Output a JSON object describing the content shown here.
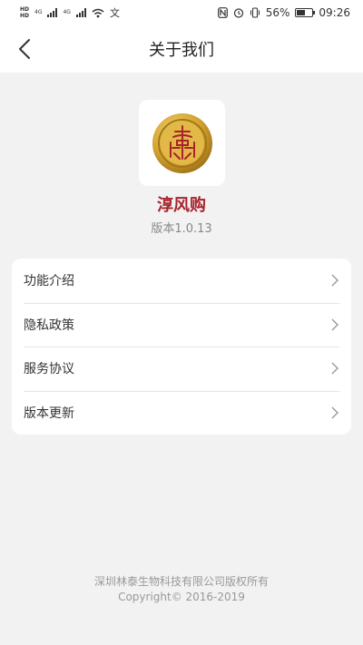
{
  "status_bar": {
    "hd1": "HD",
    "net1": "4G",
    "hd2": "HD",
    "net2": "4G",
    "extra_icon": "文",
    "battery_percent": "56%",
    "battery_level": 0.56,
    "time": "09:26"
  },
  "header": {
    "title": "关于我们",
    "back_icon": "chevron-left-icon"
  },
  "app": {
    "name": "淳风购",
    "version": "版本1.0.13",
    "logo_icon": "gold-coin-logo"
  },
  "menu": {
    "items": [
      {
        "label": "功能介绍",
        "icon": "chevron-right-icon"
      },
      {
        "label": "隐私政策",
        "icon": "chevron-right-icon"
      },
      {
        "label": "服务协议",
        "icon": "chevron-right-icon"
      },
      {
        "label": "版本更新",
        "icon": "chevron-right-icon"
      }
    ]
  },
  "footer": {
    "company": "深圳林泰生物科技有限公司版权所有",
    "copyright": "Copyright© 2016-2019"
  },
  "colors": {
    "brand": "#a8232b",
    "background": "#f2f2f2",
    "card": "#ffffff",
    "gold": "#d4a531"
  }
}
